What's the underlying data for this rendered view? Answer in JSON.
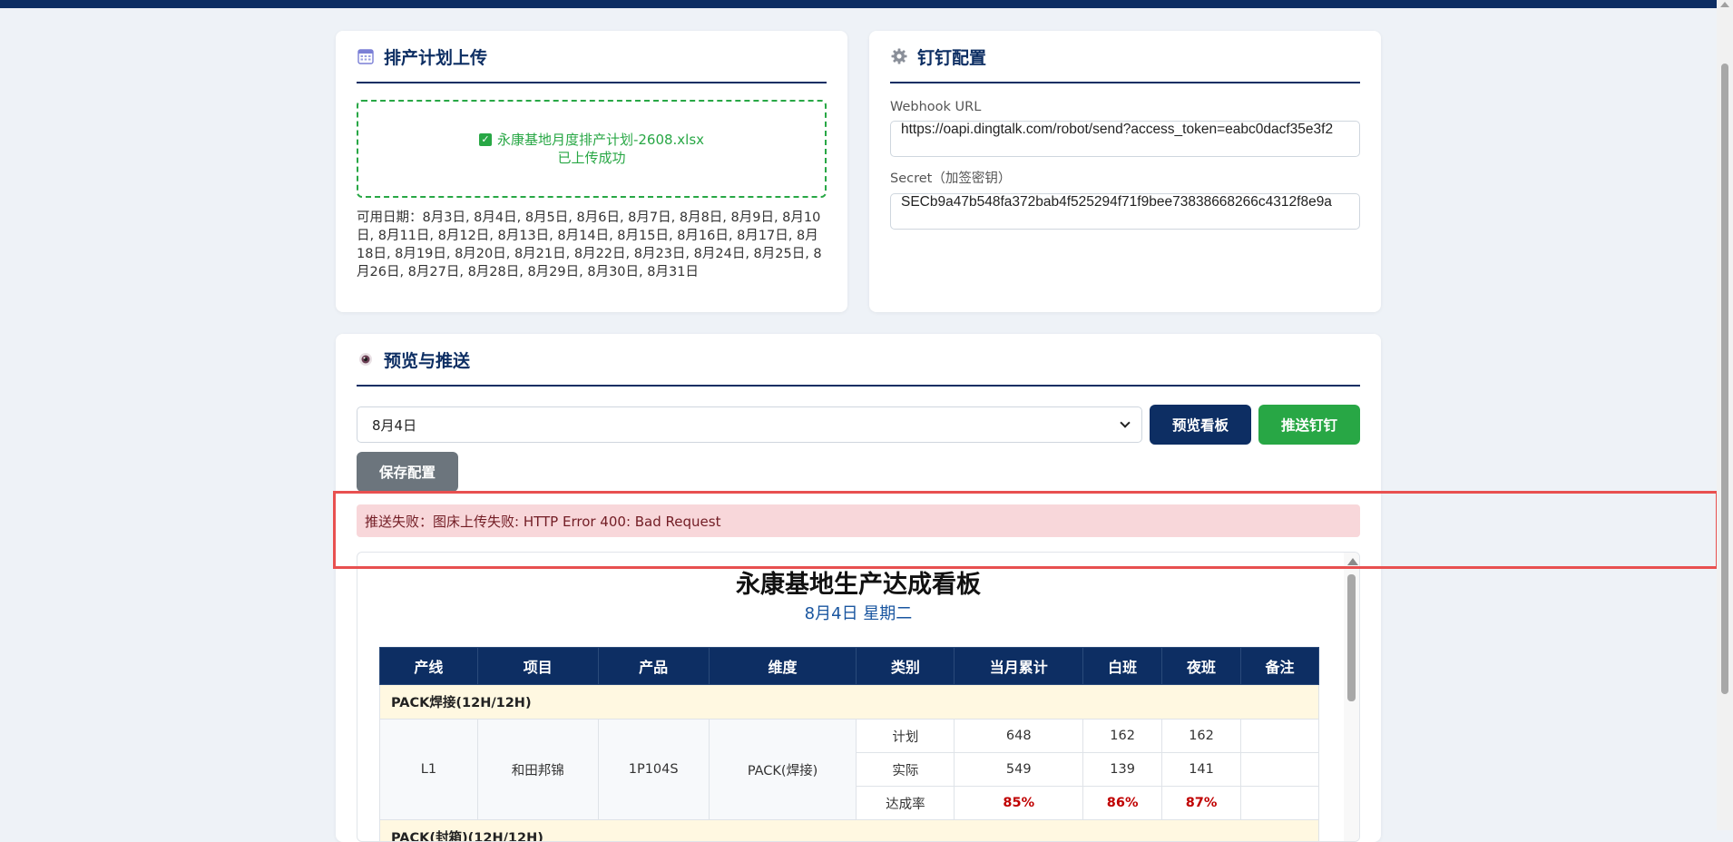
{
  "upload": {
    "title": "排产计划上传",
    "file_name": "永康基地月度排产计划-2608.xlsx",
    "status": "已上传成功",
    "available_dates": "可用日期：8月3日, 8月4日, 8月5日, 8月6日, 8月7日, 8月8日, 8月9日, 8月10日, 8月11日, 8月12日, 8月13日, 8月14日, 8月15日, 8月16日, 8月17日, 8月18日, 8月19日, 8月20日, 8月21日, 8月22日, 8月23日, 8月24日, 8月25日, 8月26日, 8月27日, 8月28日, 8月29日, 8月30日, 8月31日"
  },
  "config": {
    "title": "钉钉配置",
    "webhook_label": "Webhook URL",
    "webhook_value": "https://oapi.dingtalk.com/robot/send?access_token=eabc0dacf35e3f2",
    "secret_label": "Secret（加签密钥）",
    "secret_value": "SECb9a47b548fa372bab4f525294f71f9bee73838668266c4312f8e9a"
  },
  "preview": {
    "title": "预览与推送",
    "selected_date": "8月4日",
    "preview_button": "预览看板",
    "push_button": "推送钉钉",
    "save_button": "保存配置",
    "error_message": "推送失败：图床上传失败: HTTP Error 400: Bad Request"
  },
  "board": {
    "title": "永康基地生产达成看板",
    "date": "8月4日 星期二",
    "columns": [
      "产线",
      "项目",
      "产品",
      "维度",
      "类别",
      "当月累计",
      "白班",
      "夜班",
      "备注"
    ],
    "group1": "PACK焊接(12H/12H)",
    "row": {
      "line": "L1",
      "project": "和田邦锦",
      "product": "1P104S",
      "dimension": "PACK(焊接)",
      "plan": {
        "label": "计划",
        "month": "648",
        "day": "162",
        "night": "162",
        "note": ""
      },
      "actual": {
        "label": "实际",
        "month": "549",
        "day": "139",
        "night": "141",
        "note": ""
      },
      "rate": {
        "label": "达成率",
        "month": "85%",
        "day": "86%",
        "night": "87%",
        "note": ""
      }
    },
    "group2": "PACK(封箱)(12H/12H)"
  }
}
